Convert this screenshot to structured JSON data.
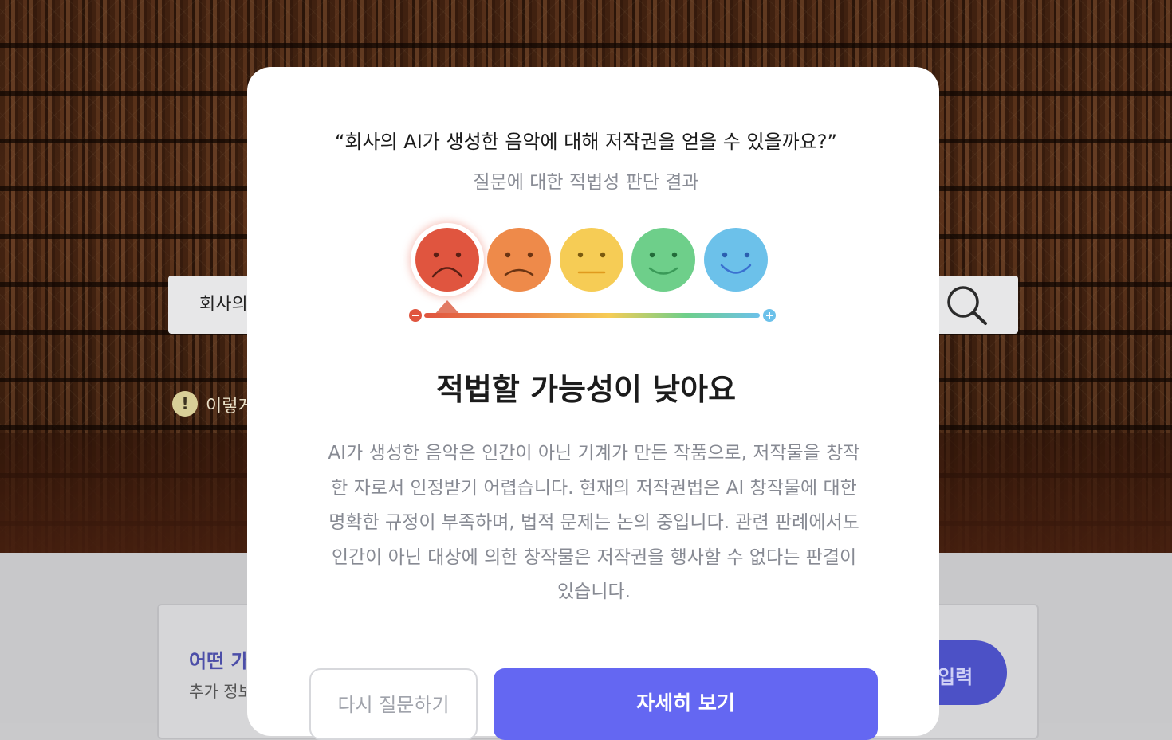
{
  "background": {
    "search_text": "회사의 AI가 생성한 음악에 대해 저작권을 얻을 수 있을까요?",
    "notice_text": "이렇게",
    "card_title": "어떤 가",
    "card_sub": "추가 정보",
    "input_button_label": "입력"
  },
  "modal": {
    "question": "“회사의 AI가 생성한 음악에 대해 저작권을 얻을 수 있을까요?”",
    "subtitle": "질문에 대한 적법성 판단 결과",
    "scale": {
      "faces": [
        {
          "name": "very-sad-face-icon",
          "color": "#e0553f"
        },
        {
          "name": "sad-face-icon",
          "color": "#ee8a4a"
        },
        {
          "name": "neutral-face-icon",
          "color": "#f6cc55"
        },
        {
          "name": "smile-face-icon",
          "color": "#6ecf8a"
        },
        {
          "name": "happy-face-icon",
          "color": "#6cc1ea"
        }
      ],
      "selected_index": 0,
      "minus_symbol": "−",
      "plus_symbol": "+"
    },
    "result_title": "적법할 가능성이 낮아요",
    "description": "AI가 생성한 음악은 인간이 아닌 기계가 만든 작품으로, 저작물을 창작한 자로서 인정받기 어렵습니다. 현재의 저작권법은 AI 창작물에 대한 명확한 규정이 부족하며, 법적 문제는 논의 중입니다. 관련 판례에서도 인간이 아닌 대상에 의한 창작물은 저작권을 행사할 수 없다는 판결이 있습니다.",
    "retry_button": "다시 질문하기",
    "detail_button": "자세히 보기"
  }
}
